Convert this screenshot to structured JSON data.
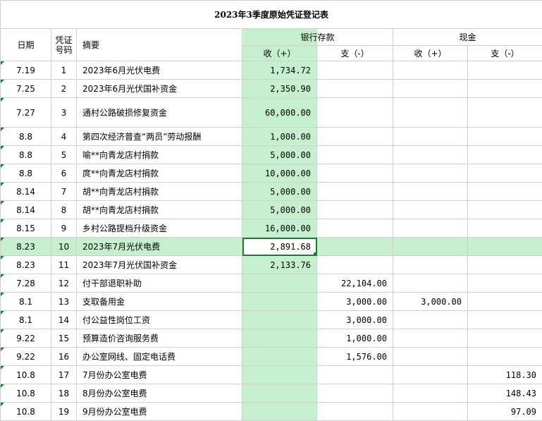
{
  "title": "2023年3季度原始凭证登记表",
  "headers": {
    "date": "日期",
    "voucher_no": "凭证号码",
    "summary": "摘要",
    "bank": "银行存款",
    "cash": "现金",
    "income": "收（+）",
    "expense": "支（-）"
  },
  "colors": {
    "bank_fill": "#c6efce",
    "selection_border": "#1e7b34",
    "grid_line": "#cfcfcf"
  },
  "rows": [
    {
      "date": "7.19",
      "no": "1",
      "summary": "2023年6月光伏电费",
      "bank_in": "1,734.72",
      "bank_out": "",
      "cash_in": "",
      "cash_out": ""
    },
    {
      "date": "7.25",
      "no": "2",
      "summary": "2023年6月光伏国补资金",
      "bank_in": "2,350.90",
      "bank_out": "",
      "cash_in": "",
      "cash_out": ""
    },
    {
      "date": "7.27",
      "no": "3",
      "summary": "通村公路破损修复资金",
      "bank_in": "60,000.00",
      "bank_out": "",
      "cash_in": "",
      "cash_out": ""
    },
    {
      "date": "8.8",
      "no": "4",
      "summary": "第四次经济普查“两员”劳动报酬",
      "bank_in": "1,000.00",
      "bank_out": "",
      "cash_in": "",
      "cash_out": ""
    },
    {
      "date": "8.8",
      "no": "5",
      "summary": "喻**向青龙店村捐款",
      "bank_in": "5,000.00",
      "bank_out": "",
      "cash_in": "",
      "cash_out": ""
    },
    {
      "date": "8.8",
      "no": "6",
      "summary": "庹**向青龙店村捐款",
      "bank_in": "10,000.00",
      "bank_out": "",
      "cash_in": "",
      "cash_out": ""
    },
    {
      "date": "8.14",
      "no": "7",
      "summary": "胡**向青龙店村捐款",
      "bank_in": "5,000.00",
      "bank_out": "",
      "cash_in": "",
      "cash_out": ""
    },
    {
      "date": "8.14",
      "no": "8",
      "summary": "胡**向青龙店村捐款",
      "bank_in": "5,000.00",
      "bank_out": "",
      "cash_in": "",
      "cash_out": ""
    },
    {
      "date": "8.15",
      "no": "9",
      "summary": "乡村公路提档升级资金",
      "bank_in": "16,000.00",
      "bank_out": "",
      "cash_in": "",
      "cash_out": ""
    },
    {
      "date": "8.23",
      "no": "10",
      "summary": "2023年7月光伏电费",
      "bank_in": "2,891.68",
      "bank_out": "",
      "cash_in": "",
      "cash_out": ""
    },
    {
      "date": "8.23",
      "no": "11",
      "summary": "2023年7月光伏国补资金",
      "bank_in": "2,133.76",
      "bank_out": "",
      "cash_in": "",
      "cash_out": ""
    },
    {
      "date": "7.28",
      "no": "12",
      "summary": "付干部退职补助",
      "bank_in": "",
      "bank_out": "22,104.00",
      "cash_in": "",
      "cash_out": ""
    },
    {
      "date": "8.1",
      "no": "13",
      "summary": "支取备用金",
      "bank_in": "",
      "bank_out": "3,000.00",
      "cash_in": "3,000.00",
      "cash_out": ""
    },
    {
      "date": "8.1",
      "no": "14",
      "summary": "付公益性岗位工资",
      "bank_in": "",
      "bank_out": "3,000.00",
      "cash_in": "",
      "cash_out": ""
    },
    {
      "date": "9.22",
      "no": "15",
      "summary": "预算造价咨询服务费",
      "bank_in": "",
      "bank_out": "1,000.00",
      "cash_in": "",
      "cash_out": ""
    },
    {
      "date": "9.22",
      "no": "16",
      "summary": "办公室网线、固定电话费",
      "bank_in": "",
      "bank_out": "1,576.00",
      "cash_in": "",
      "cash_out": ""
    },
    {
      "date": "10.8",
      "no": "17",
      "summary": "7月份办公室电费",
      "bank_in": "",
      "bank_out": "",
      "cash_in": "",
      "cash_out": "118.30"
    },
    {
      "date": "10.8",
      "no": "18",
      "summary": "8月份办公室电费",
      "bank_in": "",
      "bank_out": "",
      "cash_in": "",
      "cash_out": "148.43"
    },
    {
      "date": "10.8",
      "no": "19",
      "summary": "9月份办公室电费",
      "bank_in": "",
      "bank_out": "",
      "cash_in": "",
      "cash_out": "97.09"
    }
  ]
}
